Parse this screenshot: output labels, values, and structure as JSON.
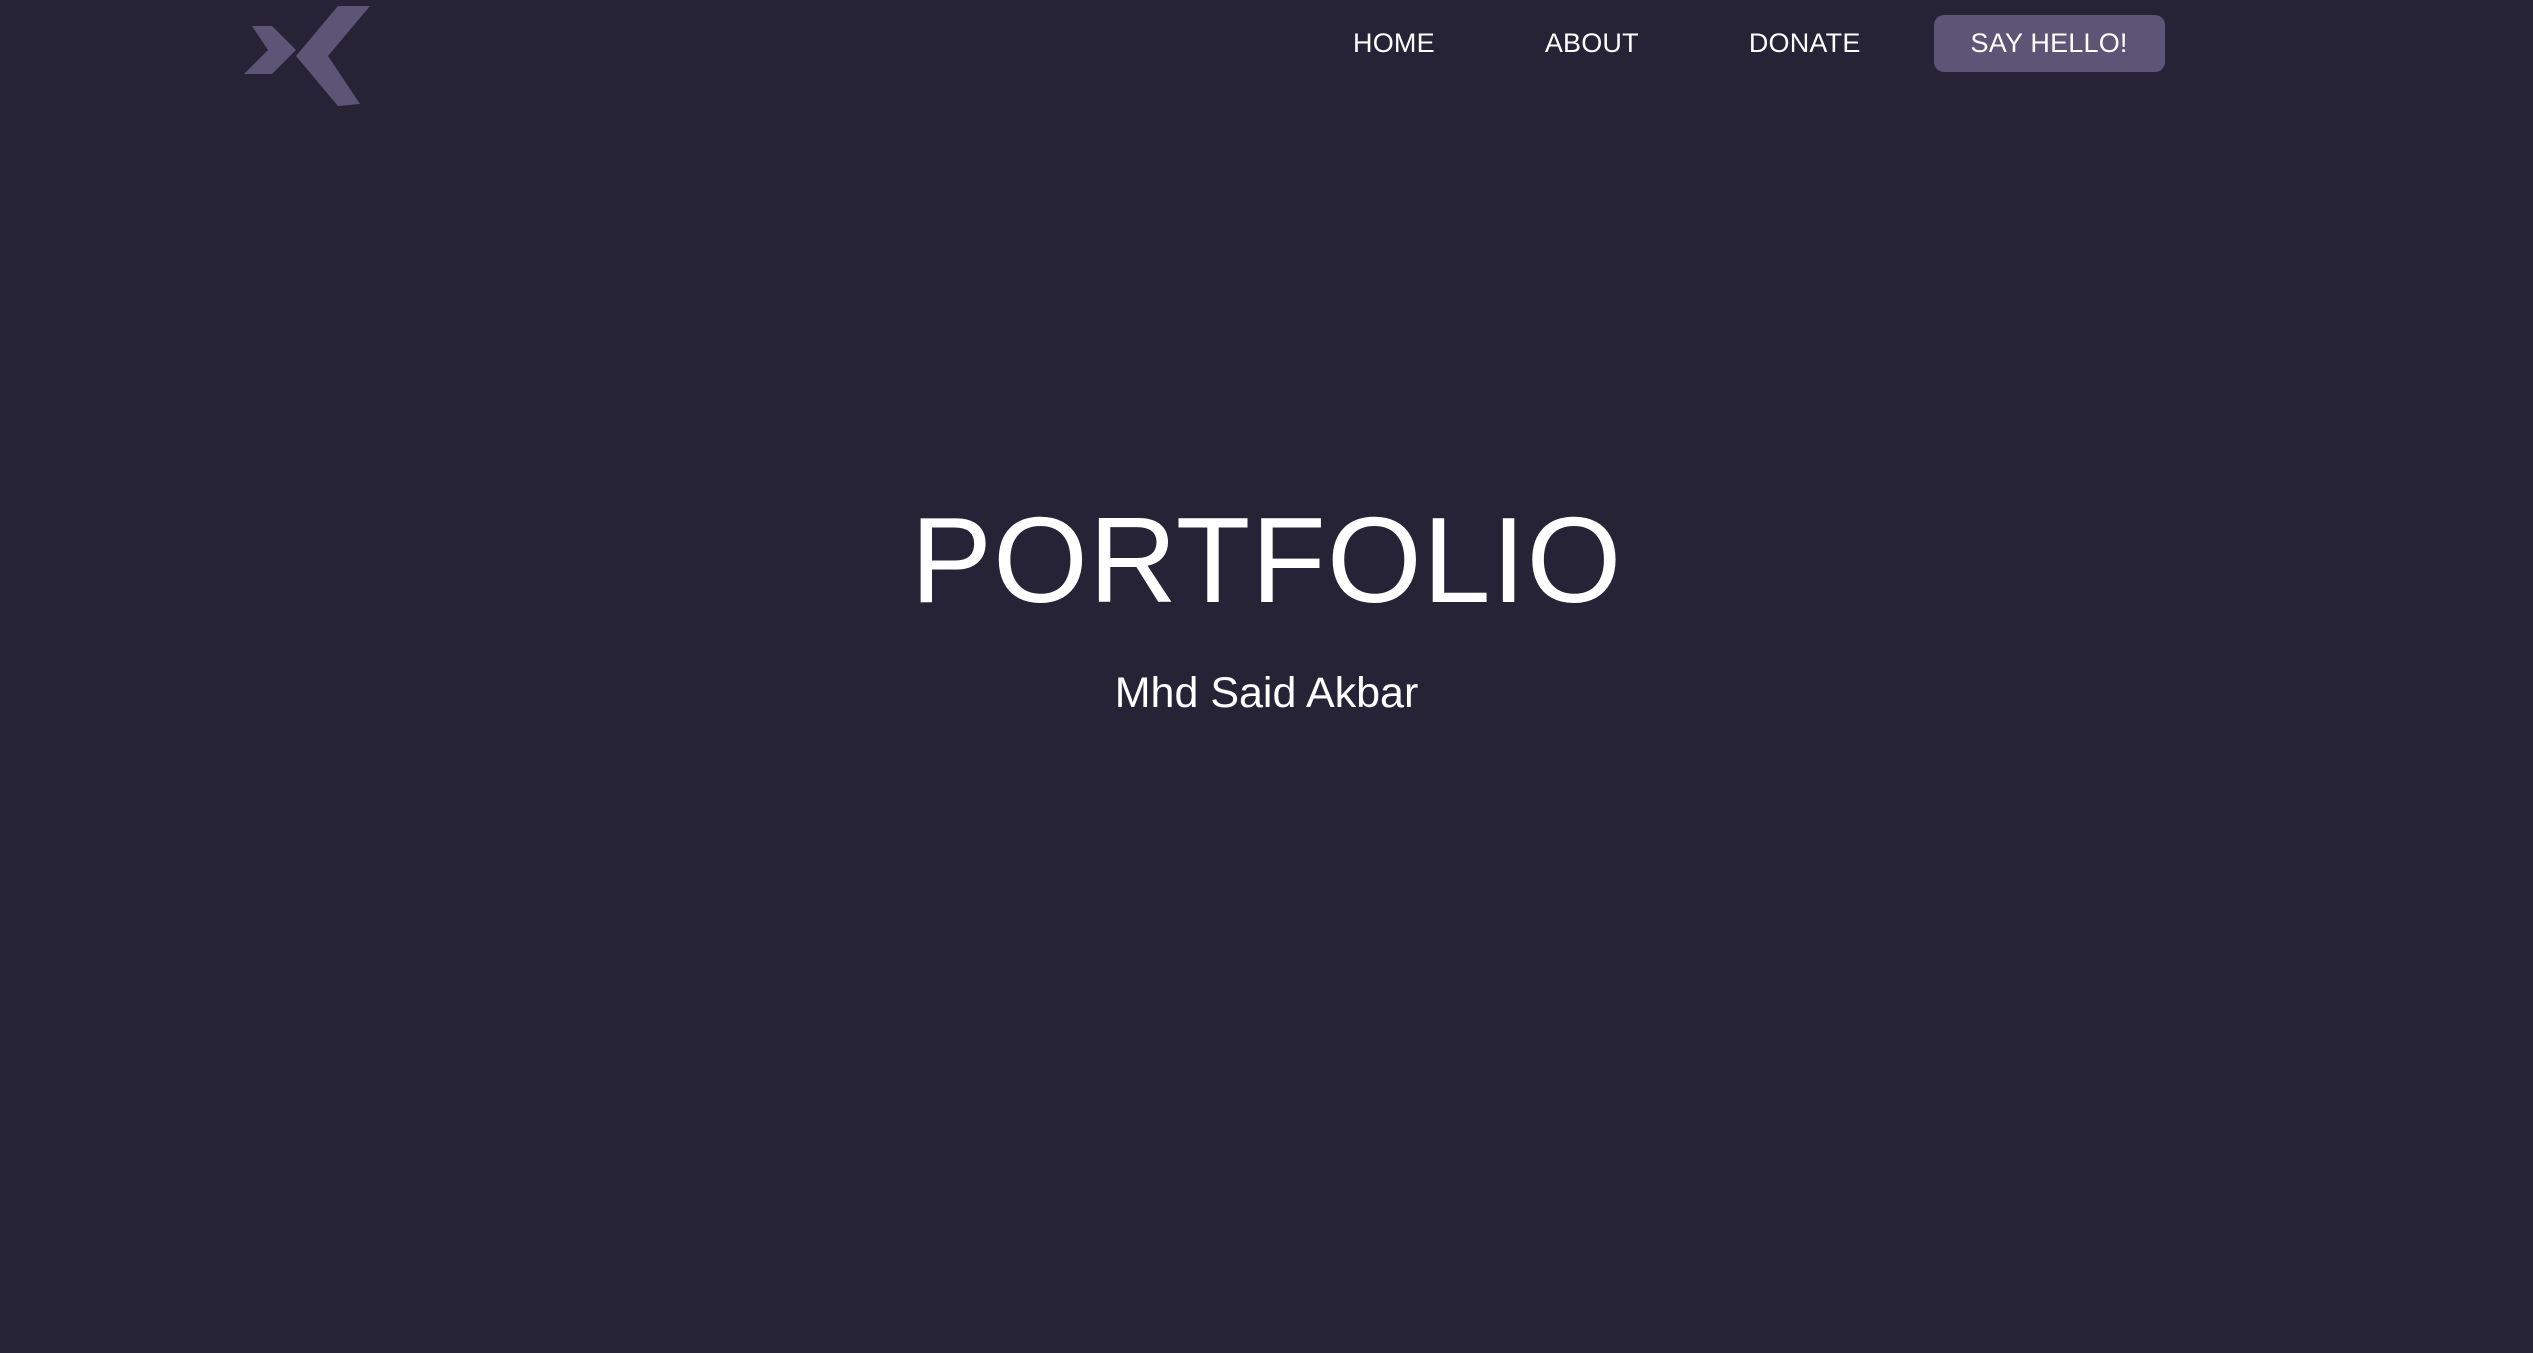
{
  "colors": {
    "background": "#272337",
    "logo": "#5c5576",
    "button": "#5c5576",
    "text": "#ffffff"
  },
  "header": {
    "logo_icon": "double-chevron-logo",
    "nav": {
      "home": "HOME",
      "about": "ABOUT",
      "donate": "DONATE"
    },
    "cta_label": "SAY HELLO!"
  },
  "hero": {
    "title": "PORTFOLIO",
    "subtitle": "Mhd Said Akbar"
  }
}
